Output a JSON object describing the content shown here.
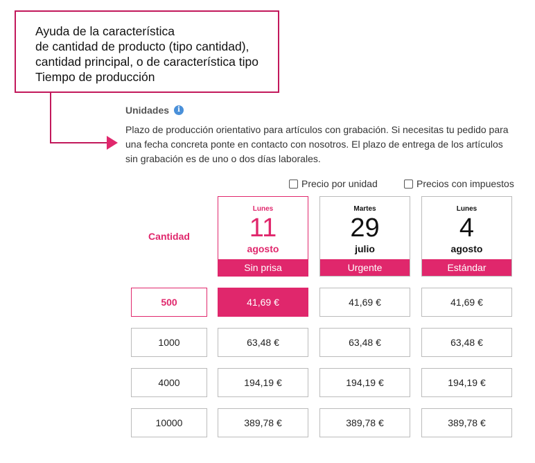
{
  "callout": {
    "text": "Ayuda de la característica\nde cantidad de producto (tipo cantidad),\ncantidad principal, o de característica tipo\nTiempo de producción",
    "border_color": "#c2185b"
  },
  "section": {
    "title": "Unidades",
    "info_icon": "info-icon",
    "description": "Plazo de producción orientativo para artículos con grabación. Si necesitas tu pedido para una fecha concreta ponte en contacto con nosotros. El plazo de entrega de los artículos sin grabación es de uno o dos días laborales."
  },
  "options": {
    "unit_price_label": "Precio por unidad",
    "unit_price_checked": false,
    "with_tax_label": "Precios con impuestos",
    "with_tax_checked": false
  },
  "table": {
    "qty_header": "Cantidad",
    "accent_color": "#e0276c",
    "dates": [
      {
        "weekday": "Lunes",
        "day": "11",
        "month": "agosto",
        "type": "Sin prisa",
        "active": true
      },
      {
        "weekday": "Martes",
        "day": "29",
        "month": "julio",
        "type": "Urgente",
        "active": false
      },
      {
        "weekday": "Lunes",
        "day": "4",
        "month": "agosto",
        "type": "Estándar",
        "active": false
      }
    ],
    "rows": [
      {
        "qty": "500",
        "prices": [
          "41,69 €",
          "41,69 €",
          "41,69 €"
        ],
        "selected": true
      },
      {
        "qty": "1000",
        "prices": [
          "63,48 €",
          "63,48 €",
          "63,48 €"
        ],
        "selected": false
      },
      {
        "qty": "4000",
        "prices": [
          "194,19 €",
          "194,19 €",
          "194,19 €"
        ],
        "selected": false
      },
      {
        "qty": "10000",
        "prices": [
          "389,78 €",
          "389,78 €",
          "389,78 €"
        ],
        "selected": false
      }
    ]
  }
}
